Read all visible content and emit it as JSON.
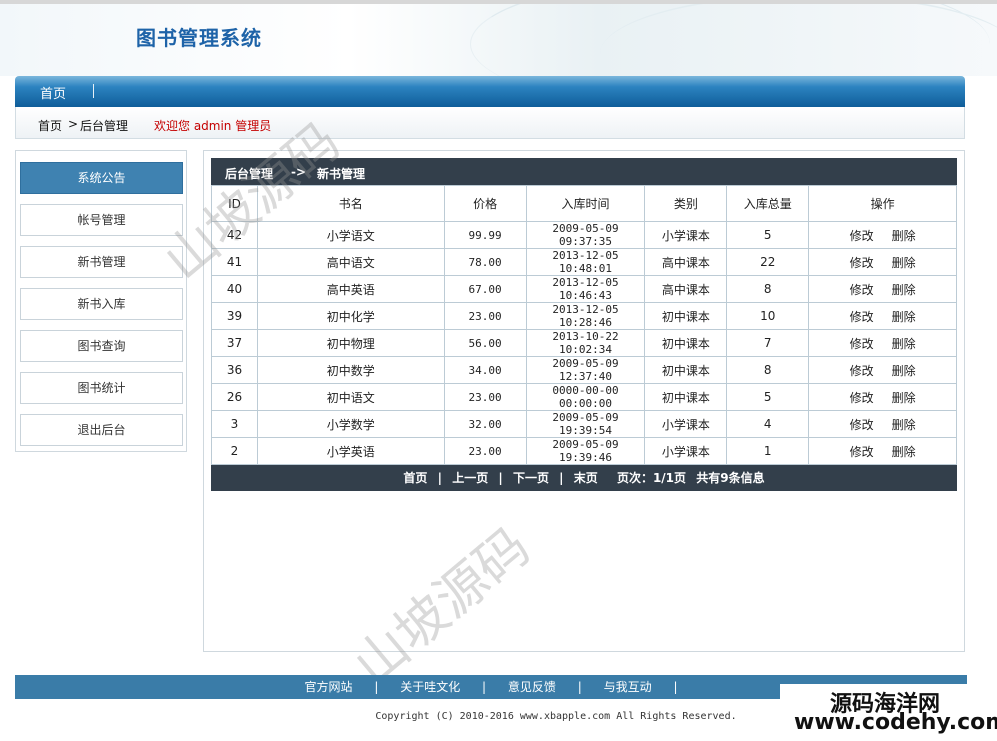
{
  "app": {
    "title": "图书管理系统"
  },
  "nav": {
    "items": [
      {
        "label": "首页"
      }
    ]
  },
  "breadcrumb": {
    "home": "首页",
    "separator": ">",
    "current": "后台管理",
    "welcome": "欢迎您 admin 管理员"
  },
  "sidebar": {
    "items": [
      {
        "label": "系统公告",
        "active": true
      },
      {
        "label": "帐号管理"
      },
      {
        "label": "新书管理"
      },
      {
        "label": "新书入库"
      },
      {
        "label": "图书查询"
      },
      {
        "label": "图书统计"
      },
      {
        "label": "退出后台"
      }
    ]
  },
  "panel": {
    "crumb_root": "后台管理",
    "crumb_arrow": "->",
    "crumb_current": "新书管理"
  },
  "table": {
    "columns": [
      "ID",
      "书名",
      "价格",
      "入库时间",
      "类别",
      "入库总量",
      "操作"
    ],
    "edit_label": "修改",
    "delete_label": "删除",
    "rows": [
      {
        "id": "42",
        "name": "小学语文",
        "price": "99.99",
        "time": "2009-05-09 09:37:35",
        "category": "小学课本",
        "total": "5"
      },
      {
        "id": "41",
        "name": "高中语文",
        "price": "78.00",
        "time": "2013-12-05 10:48:01",
        "category": "高中课本",
        "total": "22"
      },
      {
        "id": "40",
        "name": "高中英语",
        "price": "67.00",
        "time": "2013-12-05 10:46:43",
        "category": "高中课本",
        "total": "8"
      },
      {
        "id": "39",
        "name": "初中化学",
        "price": "23.00",
        "time": "2013-12-05 10:28:46",
        "category": "初中课本",
        "total": "10"
      },
      {
        "id": "37",
        "name": "初中物理",
        "price": "56.00",
        "time": "2013-10-22 10:02:34",
        "category": "初中课本",
        "total": "7"
      },
      {
        "id": "36",
        "name": "初中数学",
        "price": "34.00",
        "time": "2009-05-09 12:37:40",
        "category": "初中课本",
        "total": "8"
      },
      {
        "id": "26",
        "name": "初中语文",
        "price": "23.00",
        "time": "0000-00-00 00:00:00",
        "category": "初中课本",
        "total": "5"
      },
      {
        "id": "3",
        "name": "小学数学",
        "price": "32.00",
        "time": "2009-05-09 19:39:54",
        "category": "小学课本",
        "total": "4"
      },
      {
        "id": "2",
        "name": "小学英语",
        "price": "23.00",
        "time": "2009-05-09 19:39:46",
        "category": "小学课本",
        "total": "1"
      }
    ]
  },
  "pager": {
    "first": "首页",
    "prev": "上一页",
    "next": "下一页",
    "last": "末页",
    "sep": "|",
    "page_info": "页次：1/1页",
    "total_info": "共有9条信息"
  },
  "footer": {
    "links": [
      {
        "label": "官方网站"
      },
      {
        "label": "关于哇文化"
      },
      {
        "label": "意见反馈"
      },
      {
        "label": "与我互动"
      }
    ],
    "sep": "|",
    "copyright": "Copyright (C) 2010-2016 www.xbapple.com All Rights Reserved."
  },
  "watermarks": [
    "山坡源码",
    "山坡源码"
  ],
  "brand_stamp": {
    "line1": "源码海洋网",
    "line2": "www.codehy.com"
  },
  "colors": {
    "nav_blue": "#0f5d99",
    "panel_dark": "#333f4b",
    "sidebar_active": "#3f82b1",
    "welcome_red": "#c40000",
    "footer_blue": "#3a7ca8",
    "title_blue": "#1e63a8"
  }
}
